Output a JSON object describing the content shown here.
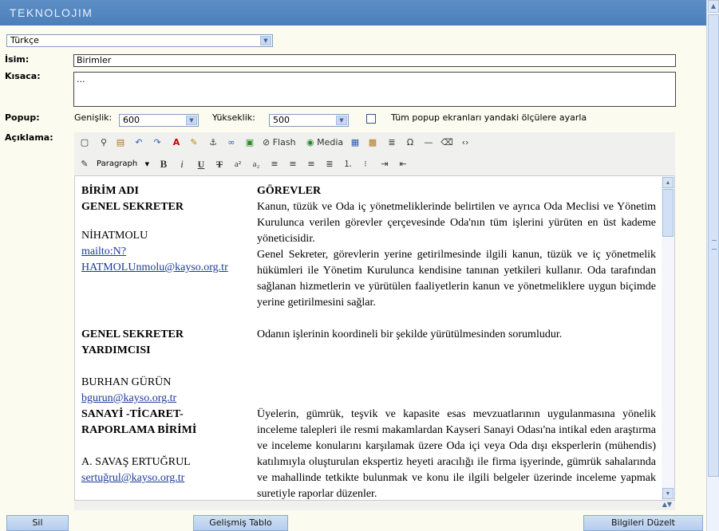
{
  "app": {
    "logo": "TEKNOLOJIM"
  },
  "language": {
    "selected": "Türkçe"
  },
  "form": {
    "name_label": "İsim:",
    "name_value": "Birimler",
    "short_label": "Kısaca:",
    "short_value": "...",
    "popup_label": "Popup:",
    "width_label": "Genişlik:",
    "width_value": "600",
    "height_label": "Yükseklik:",
    "height_value": "500",
    "all_popups_label": "Tüm popup ekranları yandaki ölçülere ayarla",
    "description_label": "Açıklama:"
  },
  "toolbar": {
    "flash_label": "Flash",
    "media_label": "Media",
    "format_select": "Paragraph",
    "icons": [
      "new-document-icon",
      "find-icon",
      "paste-icon",
      "undo-icon",
      "redo-icon",
      "text-color-icon",
      "highlight-icon",
      "anchor-icon",
      "link-icon",
      "image-icon",
      "flash-icon",
      "media-icon",
      "table-icon",
      "table-edit-icon",
      "page-break-icon",
      "special-char-icon",
      "horizontal-rule-icon",
      "remove-format-icon",
      "source-code-icon",
      "styles-icon",
      "bold-icon",
      "italic-icon",
      "underline-icon",
      "strikethrough-icon",
      "superscript-icon",
      "subscript-icon",
      "align-left-icon",
      "align-center-icon",
      "align-right-icon",
      "align-justify-icon",
      "numbered-list-icon",
      "bullet-list-icon",
      "indent-icon",
      "outdent-icon"
    ]
  },
  "editor": {
    "header_left": "BİRİM ADI",
    "header_right": "GÖREVLER",
    "rows": [
      {
        "unit": "GENEL SEKRETER",
        "person": "NİHATMOLU",
        "link1": "mailto:N?",
        "link2": "HATMOLUnmolu@kayso.org.tr",
        "duties": "Kanun, tüzük ve Oda iç yönetmeliklerinde belirtilen ve ayrıca Oda Meclisi ve Yönetim Kurulunca verilen görevler çerçevesinde Oda'nın tüm işlerini yürüten en üst kademe yöneticisidir.",
        "duties2": "Genel Sekreter, görevlerin yerine getirilmesinde ilgili kanun, tüzük ve iç yönetmelik hükümleri ile Yönetim Kurulunca kendisine tanınan yetkileri kullanır. Oda tarafından sağlanan hizmetlerin ve yürütülen faaliyetlerin kanun ve yönetmeliklere uygun biçimde yerine getirilmesini sağlar."
      },
      {
        "unit_line1": "GENEL SEKRETER",
        "unit_line2": "YARDIMCISI",
        "person": "BURHAN GÜRÜN",
        "link1": "bgurun@kayso.org.tr",
        "duties": "Odanın işlerinin koordineli bir şekilde yürütülmesinden sorumludur."
      },
      {
        "unit_line1": "SANAYİ -TİCARET-",
        "unit_line2": "RAPORLAMA BİRİMİ",
        "person": "A. SAVAŞ ERTUĞRUL",
        "link1": "sertuğrul@kayso.org.tr",
        "duties": "Üyelerin, gümrük, teşvik ve kapasite esas mevzuatlarının uygulanmasına yönelik inceleme talepleri ile resmi makamlardan Kayseri Sanayi Odası'na intikal eden araştırma ve inceleme konularını karşılamak üzere Oda içi veya Oda dışı eksperlerin (mühendis) katılımıyla oluşturulan ekspertiz heyeti aracılığı ile firma işyerinde, gümrük sahalarında ve mahallinde tetkikte bulunmak ve konu ile ilgili belgeler üzerinde inceleme yapmak suretiyle raporlar düzenler."
      }
    ]
  },
  "buttons": {
    "delete": "Sil",
    "advanced_table": "Gelişmiş Tablo",
    "edit_info": "Bilgileri Düzelt"
  }
}
